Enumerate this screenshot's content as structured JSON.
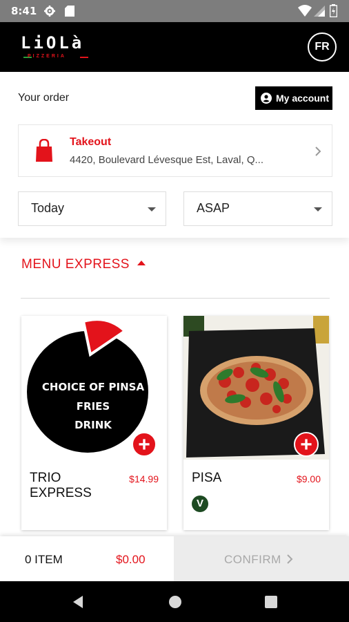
{
  "status_bar": {
    "time": "8:41"
  },
  "header": {
    "logo_text": "LiOLà",
    "logo_sub": "PIZZERIA",
    "lang_button": "FR"
  },
  "order": {
    "title": "Your order",
    "account_button": "My account",
    "mode_title": "Takeout",
    "address": "4420, Boulevard Lévesque Est, Laval, Q...",
    "day_select": "Today",
    "time_select": "ASAP"
  },
  "menu": {
    "section_title": "MENU EXPRESS",
    "items": [
      {
        "name": "TRIO EXPRESS",
        "price": "$14.99",
        "image_lines": [
          "CHOICE OF PINSA",
          "FRIES",
          "DRINK"
        ]
      },
      {
        "name": "PISA",
        "price": "$9.00",
        "badge": "V"
      }
    ]
  },
  "cart": {
    "items_label": "0 ITEM",
    "total": "$0.00",
    "confirm_label": "CONFIRM"
  },
  "colors": {
    "accent": "#e3131b",
    "header_bg": "#000000",
    "veg_badge": "#1d4a22"
  }
}
